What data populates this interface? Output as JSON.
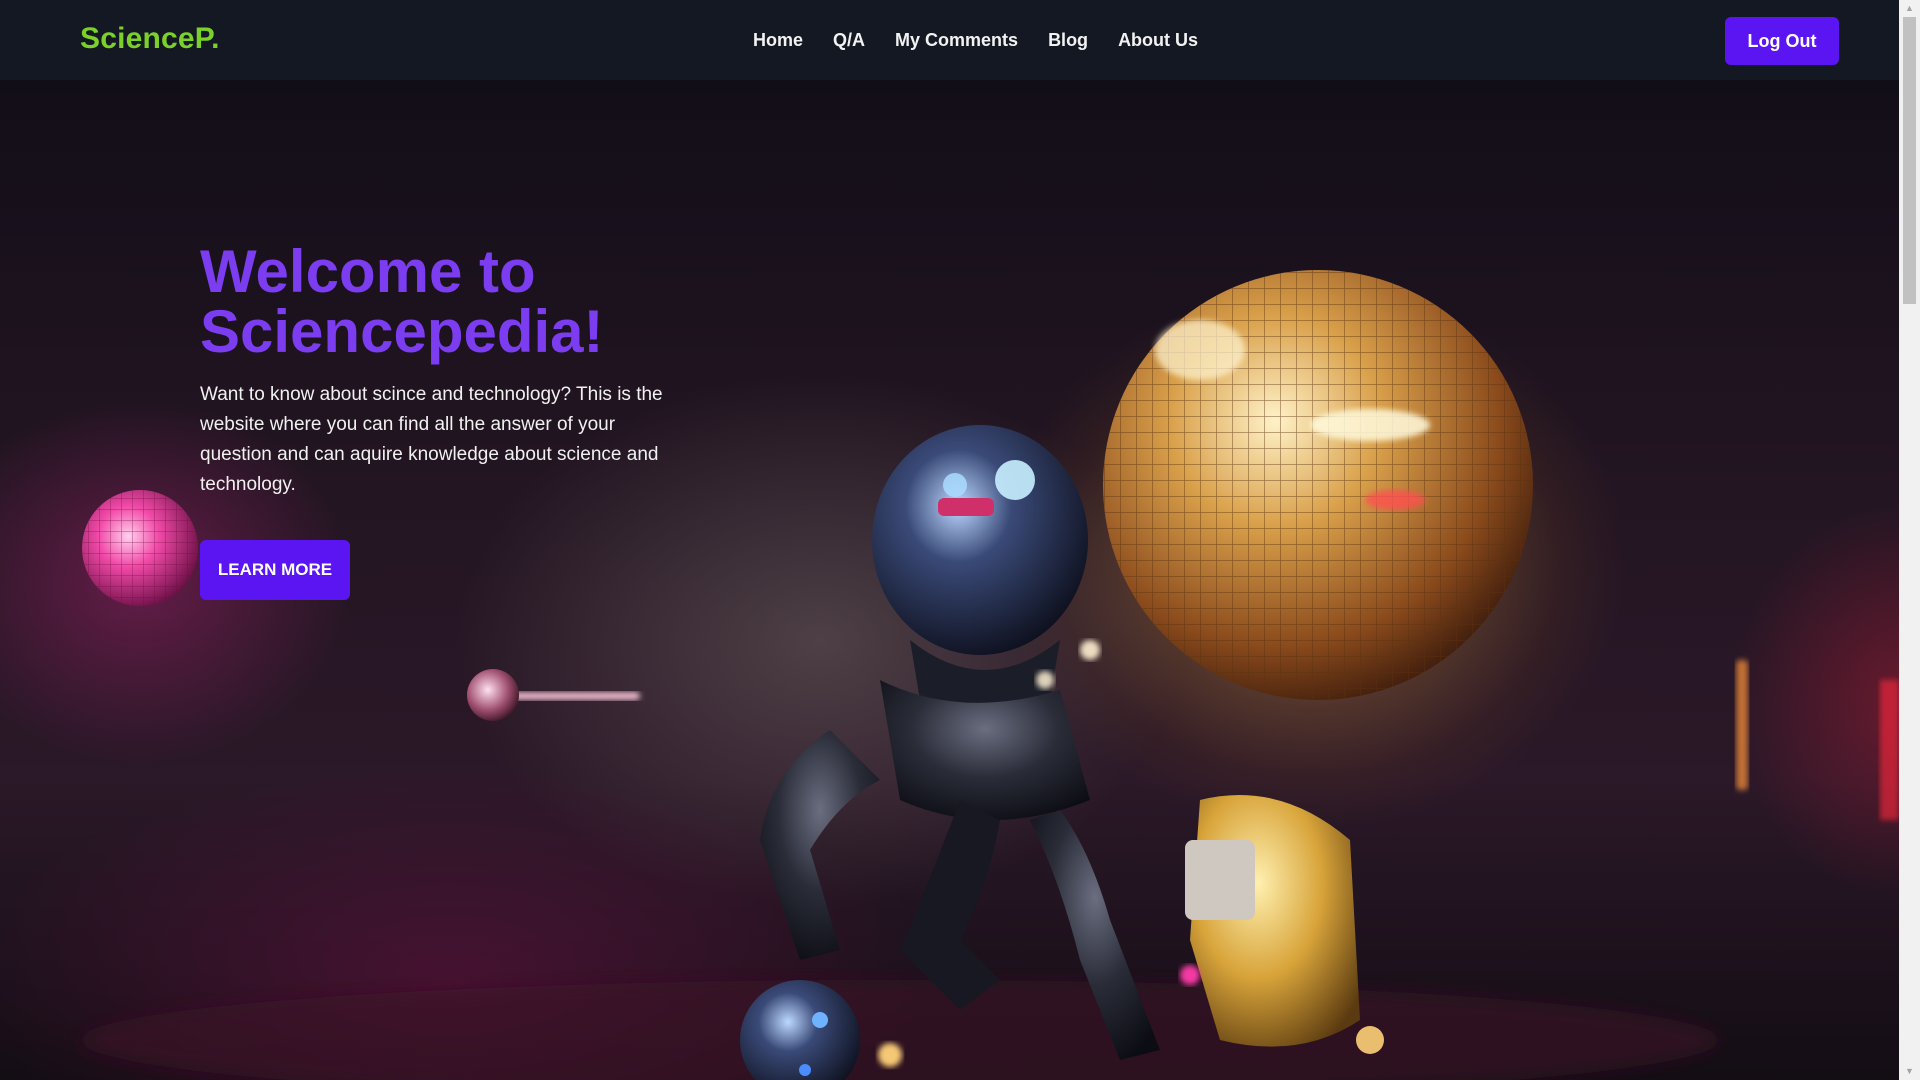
{
  "header": {
    "brand": "ScienceP.",
    "nav": [
      {
        "label": "Home"
      },
      {
        "label": "Q/A"
      },
      {
        "label": "My Comments"
      },
      {
        "label": "Blog"
      },
      {
        "label": "About Us"
      }
    ],
    "logout_label": "Log Out"
  },
  "hero": {
    "title": "Welcome to Sciencepedia!",
    "description": "Want to know about scince and technology? This is the website where you can find all the answer of your question and can aquire knowledge about science and technology.",
    "cta_label": "LEARN MORE"
  },
  "theme": {
    "brand_color": "#7bd02a",
    "accent": "#5b14f2",
    "title_color": "#7c3df0",
    "navbar_bg": "#131822"
  }
}
